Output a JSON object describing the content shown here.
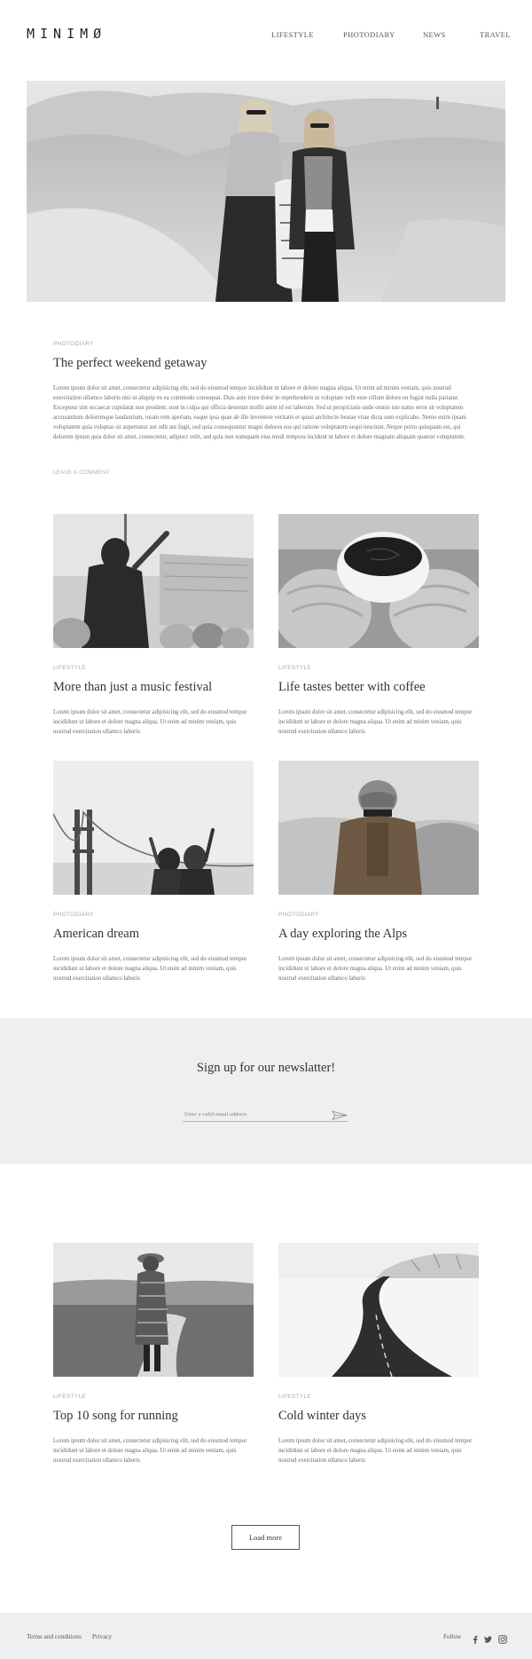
{
  "header": {
    "logo": "MINIMØ",
    "nav": [
      "LIFESTYLE",
      "PHOTODIARY",
      "NEWS",
      "TRAVEL"
    ]
  },
  "featured": {
    "category": "PHOTODIARY",
    "title": "The perfect weekend getaway",
    "body": "Lorem ipsum dolor sit amet, consectetur adipisicing elit, sed do eiusmod tempor incididunt ut labore et dolore magna aliqua. Ut enim ad minim veniam, quis nostrud exercitation ullamco laboris nisi ut aliquip ex ea commodo consequat. Duis aute irure dolor in reprehenderit in voluptate velit esse cillum dolore eu fugiat nulla pariatur. Excepteur sint occaecat cupidatat non proident, sunt in culpa qui officia deserunt mollit anim id est laborum. Sed ut perspiciatis unde omnis iste natus error sit voluptatem accusantium doloremque laudantium, totam rem aperiam, eaque ipsa quae ab illo inventore veritatis et quasi architecto beatae vitae dicta sunt explicabo. Nemo enim ipsam voluptatem quia voluptas sit aspernatur aut odit aut fugit, sed quia consequuntur magni dolores eos qui ratione voluptatem sequi nesciunt. Neque porro quisquam est, qui dolorem ipsum quia dolor sit amet, consectetur, adipisci velit, sed quia non numquam eius modi tempora incidunt ut labore et dolore magnam aliquam quaerat voluptatem.",
    "comment_link": "LEAVE A COMMENT"
  },
  "posts": [
    {
      "category": "LIFESTYLE",
      "title": "More than just a music festival",
      "excerpt": "Lorem ipsum dolor sit amet, consectetur adipisicing elit, sed do eiusmod tempor incididunt ut labore et dolore magna aliqua. Ut enim ad minim veniam, quis nostrud exercitation ullamco laboris"
    },
    {
      "category": "LIFESTYLE",
      "title": "Life tastes better with coffee",
      "excerpt": "Lorem ipsum dolor sit amet, consectetur adipisicing elit, sed do eiusmod tempor incididunt ut labore et dolore magna aliqua. Ut enim ad minim veniam, quis nostrud exercitation ullamco laboris"
    },
    {
      "category": "PHOTODIARY",
      "title": "American dream",
      "excerpt": "Lorem ipsum dolor sit amet, consectetur adipisicing elit, sed do eiusmod tempor incididunt ut labore et dolore magna aliqua. Ut enim ad minim veniam, quis nostrud exercitation ullamco laboris"
    },
    {
      "category": "PHOTODIARY",
      "title": "A day exploring the Alps",
      "excerpt": "Lorem ipsum dolor sit amet, consectetur adipisicing elit, sed do eiusmod tempor incididunt ut labore et dolore magna aliqua. Ut enim ad minim veniam, quis nostrud exercitation ullamco laboris"
    },
    {
      "category": "LIFESTYLE",
      "title": "Top 10 song for running",
      "excerpt": "Lorem ipsum dolor sit amet, consectetur adipisicing elit, sed do eiusmod tempor incididunt ut labore et dolore magna aliqua. Ut enim ad minim veniam, quis nostrud exercitation ullamco laboris"
    },
    {
      "category": "LIFESTYLE",
      "title": "Cold winter days",
      "excerpt": "Lorem ipsum dolor sit amet, consectetur adipisicing elit, sed do eiusmod tempor incididunt ut labore et dolore magna aliqua. Ut enim ad minim veniam, quis nostrud exercitation ullamco laboris"
    }
  ],
  "newsletter": {
    "title": "Sign up for our newslatter!",
    "placeholder": "Enter a valid email address",
    "send_icon": "paper-plane-icon"
  },
  "load_more": "Load more",
  "footer": {
    "terms": "Terms and conditions",
    "privacy": "Privacy",
    "follow": "Follow",
    "social_icons": [
      "facebook-icon",
      "twitter-icon",
      "instagram-icon"
    ]
  },
  "colors": {
    "text": "#333333",
    "muted": "#6a6a6a",
    "category": "#aaaaaa",
    "band_background": "#efefef"
  }
}
